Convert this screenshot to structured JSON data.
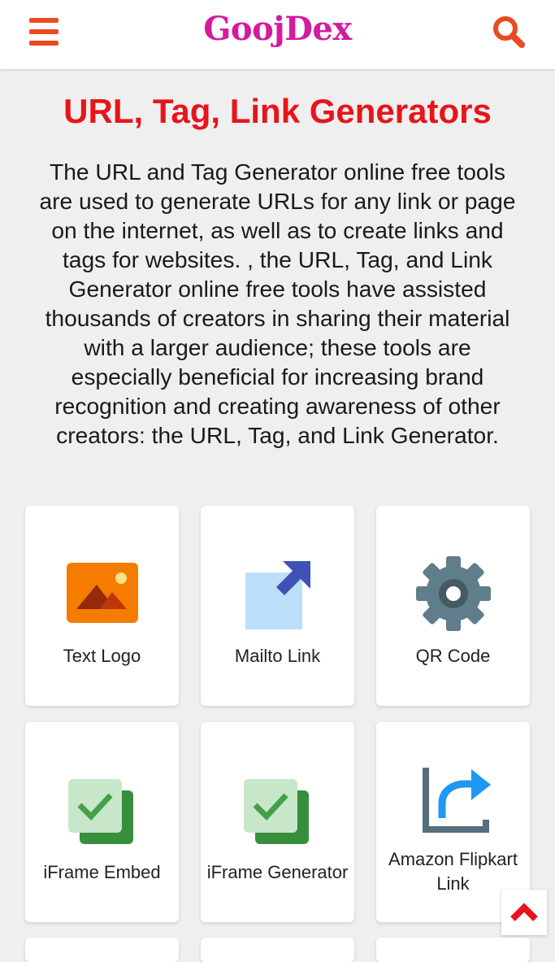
{
  "header": {
    "brand": "GoojDex",
    "menu_icon": "hamburger-menu-icon",
    "search_icon": "search-icon",
    "accent_color": "#ea4a20",
    "brand_color": "#d41a9f"
  },
  "page": {
    "title": "URL, Tag, Link Generators",
    "title_color": "#e8141b",
    "intro_lines": [
      "The URL and Tag Generator online free tools",
      "are used to generate URLs for any link or page",
      "on the internet, as well as to create links and",
      "tags for websites. , the URL, Tag, and Link",
      "Generator online free tools have assisted",
      "thousands of creators in sharing their material",
      "with a larger audience; these tools are",
      "especially beneficial for increasing brand",
      "recognition and creating awareness of other",
      "creators: the URL, Tag, and Link Generator."
    ]
  },
  "tools": [
    {
      "label": "Text Logo",
      "icon": "image-icon"
    },
    {
      "label": "Mailto Link",
      "icon": "external-link-icon"
    },
    {
      "label": "QR Code",
      "icon": "gear-icon"
    },
    {
      "label": "iFrame Embed",
      "icon": "checkbox-copy-icon"
    },
    {
      "label": "iFrame Generator",
      "icon": "checkbox-copy-icon"
    },
    {
      "label_lines": [
        "Amazon Flipkart",
        "Link"
      ],
      "icon": "share-arrow-icon"
    }
  ],
  "scroll_top_icon": "chevron-up-icon"
}
